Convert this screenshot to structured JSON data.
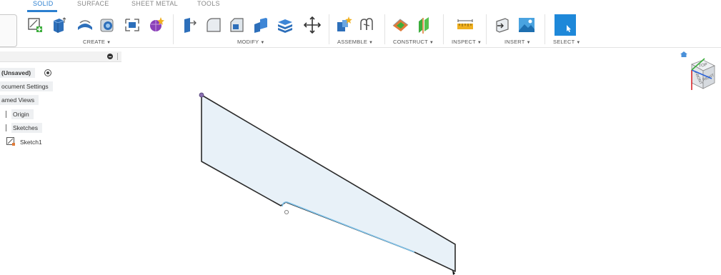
{
  "toolbar": {
    "tabs": [
      {
        "label": "SOLID",
        "active": true
      },
      {
        "label": "SURFACE",
        "active": false
      },
      {
        "label": "SHEET METAL",
        "active": false
      },
      {
        "label": "TOOLS",
        "active": false
      }
    ],
    "groups": {
      "create": "CREATE",
      "modify": "MODIFY",
      "assemble": "ASSEMBLE",
      "construct": "CONSTRUCT",
      "inspect": "INSPECT",
      "insert": "INSERT",
      "select": "SELECT"
    },
    "colors": {
      "accent": "#2b7fd0",
      "select_button": "#1e88d9"
    }
  },
  "browser": {
    "root_label": "(Unsaved)",
    "items": [
      {
        "label": "ocument Settings"
      },
      {
        "label": "amed Views"
      },
      {
        "label": "Origin"
      },
      {
        "label": "Sketches"
      },
      {
        "label": "Sketch1"
      }
    ]
  },
  "viewcube": {
    "face_top": "TOP",
    "face_front": "FRONT",
    "face_right": "RIGHT"
  },
  "sketch": {
    "profile_fill": "#e8f1f8",
    "profile_stroke": "#2a2a2a",
    "highlight_stroke": "#7cc0e8"
  }
}
